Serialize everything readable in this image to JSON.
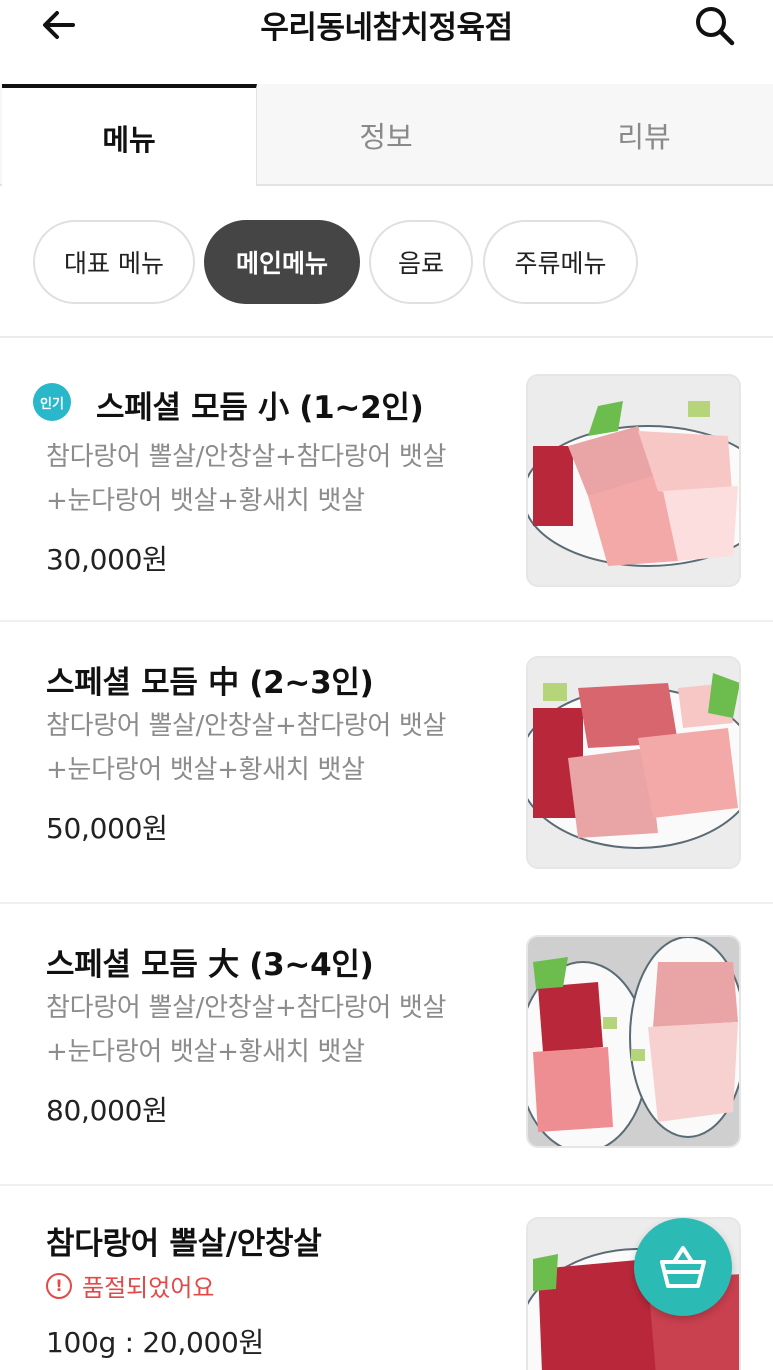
{
  "header": {
    "title": "우리동네참치정육점",
    "back_icon": "arrow-left-icon",
    "search_icon": "search-icon"
  },
  "tabs": [
    {
      "label": "메뉴",
      "active": true
    },
    {
      "label": "정보",
      "active": false
    },
    {
      "label": "리뷰",
      "active": false
    }
  ],
  "categories": [
    {
      "label": "대표 메뉴",
      "active": false
    },
    {
      "label": "메인메뉴",
      "active": true
    },
    {
      "label": "음료",
      "active": false
    },
    {
      "label": "주류메뉴",
      "active": false
    }
  ],
  "menu_items": [
    {
      "badge": "인기",
      "name": "스페셜 모듬 小 (1~2인)",
      "description": "참다랑어 뽈살/안창살+참다랑어 뱃살+눈다랑어 뱃살+황새치 뱃살",
      "price": "30,000원"
    },
    {
      "name": "스페셜 모듬 中 (2~3인)",
      "description": "참다랑어 뽈살/안창살+참다랑어 뱃살+눈다랑어 뱃살+황새치 뱃살",
      "price": "50,000원"
    },
    {
      "name": "스페셜 모듬 大 (3~4인)",
      "description": "참다랑어 뽈살/안창살+참다랑어 뱃살+눈다랑어 뱃살+황새치 뱃살",
      "price": "80,000원"
    },
    {
      "name": "참다랑어 뽈살/안창살",
      "status": "품절되었어요",
      "price": "100g : 20,000원"
    }
  ],
  "cart_icon": "shopping-basket-icon",
  "colors": {
    "accent": "#2bbbb4",
    "badge": "#29b8c9",
    "soldout": "#e24a4a",
    "active_chip": "#454545"
  }
}
